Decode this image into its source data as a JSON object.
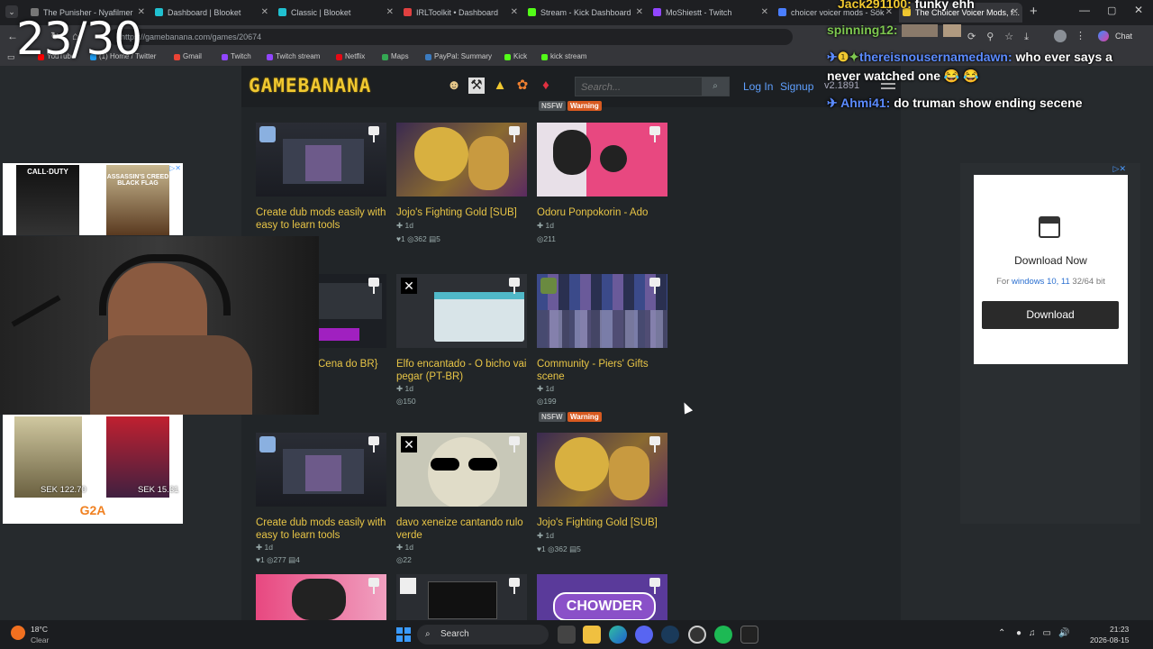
{
  "browser": {
    "tabs": [
      {
        "label": "The Punisher - Nyafilmer",
        "color": "#777"
      },
      {
        "label": "Dashboard | Blooket",
        "color": "#20c0d0"
      },
      {
        "label": "Classic | Blooket",
        "color": "#20c0d0"
      },
      {
        "label": "IRLToolkit • Dashboard",
        "color": "#e04040"
      },
      {
        "label": "Stream - Kick Dashboard",
        "color": "#53fc18"
      },
      {
        "label": "MoShiestt - Twitch",
        "color": "#9146ff"
      },
      {
        "label": "choicer voicer mods - Sök",
        "color": "#4a7eff"
      },
      {
        "label": "The Choicer Voicer Mods, f...",
        "color": "#f0c830"
      }
    ],
    "url": "https://gamebanana.com/games/20674",
    "bookmarks": [
      {
        "label": "YouTube",
        "color": "#ff0000"
      },
      {
        "label": "(1) Home / Twitter",
        "color": "#1d9bf0"
      },
      {
        "label": "Gmail",
        "color": "#ea4335"
      },
      {
        "label": "Twitch",
        "color": "#9146ff"
      },
      {
        "label": "Twitch stream",
        "color": "#9146ff"
      },
      {
        "label": "Netflix",
        "color": "#e50914"
      },
      {
        "label": "Maps",
        "color": "#34a853"
      },
      {
        "label": "PayPal: Summary",
        "color": "#3b7bbf"
      },
      {
        "label": "Kick",
        "color": "#53fc18"
      },
      {
        "label": "kick stream",
        "color": "#53fc18"
      }
    ],
    "chat_button": "Chat"
  },
  "site": {
    "logo": "GAMEBANANA",
    "search_placeholder": "Search...",
    "search_button_icon": "magnifier-icon",
    "login": "Log In",
    "signup": "Signup",
    "version": "v2.1891"
  },
  "cards": [
    {
      "title": "Create dub mods easily with easy to learn tools",
      "age": "1d",
      "stats": ""
    },
    {
      "title": "Jojo's Fighting Gold [SUB]",
      "age": "1d",
      "stats": "♥1  ◎362  ▤5"
    },
    {
      "title": "Odoru Ponpokorin - Ado",
      "age": "1d",
      "stats": "◎211"
    },
    {
      "title": "Cena do BR}",
      "age": "",
      "stats": ""
    },
    {
      "title": "Elfo encantado - O bicho vai pegar (PT-BR)",
      "age": "1d",
      "stats": "◎150"
    },
    {
      "title": "Community - Piers' Gifts scene",
      "age": "1d",
      "stats": "◎199"
    },
    {
      "title": "Create dub mods easily with easy to learn tools",
      "age": "1d",
      "stats": "♥1  ◎277  ▤4"
    },
    {
      "title": "davo xeneize cantando rulo verde",
      "age": "1d",
      "stats": "◎22"
    },
    {
      "title": "Jojo's Fighting Gold [SUB]",
      "age": "1d",
      "stats": "♥1  ◎362  ▤5"
    }
  ],
  "badges": {
    "nsfw": "NSFW",
    "warning": "Warning"
  },
  "overlay": {
    "counter": "23/30",
    "chat": [
      {
        "user": "Jack291100:",
        "msg": "funky ehh",
        "color": "#f0c830"
      },
      {
        "user": "spinning12:",
        "msg": "",
        "color": "#7ec850"
      },
      {
        "user": "thereisnousernamedawn:",
        "msg": "who ever says a",
        "color": "#5b8bff"
      },
      {
        "user": "",
        "msg": "never watched one 😂 😂",
        "color": "#ffffff"
      },
      {
        "user": "Ahmi41:",
        "msg": "do truman show ending secene",
        "color": "#5b8bff"
      }
    ]
  },
  "ads": {
    "top_left": [
      "CALL·DUTY",
      "ASSASSIN'S CREED BLACK FLAG"
    ],
    "bottom_left": {
      "price1": "SEK 122.70",
      "price2": "SEK 15.31",
      "brand": "G2A"
    },
    "right": {
      "title": "Download Now",
      "for_prefix": "For",
      "for_link": "windows 10, 11",
      "for_suffix": "32/64 bit",
      "button": "Download"
    }
  },
  "taskbar": {
    "weather_temp": "18°C",
    "weather_desc": "Clear",
    "search": "Search",
    "time": "21:23",
    "date": "2026-08-15"
  }
}
